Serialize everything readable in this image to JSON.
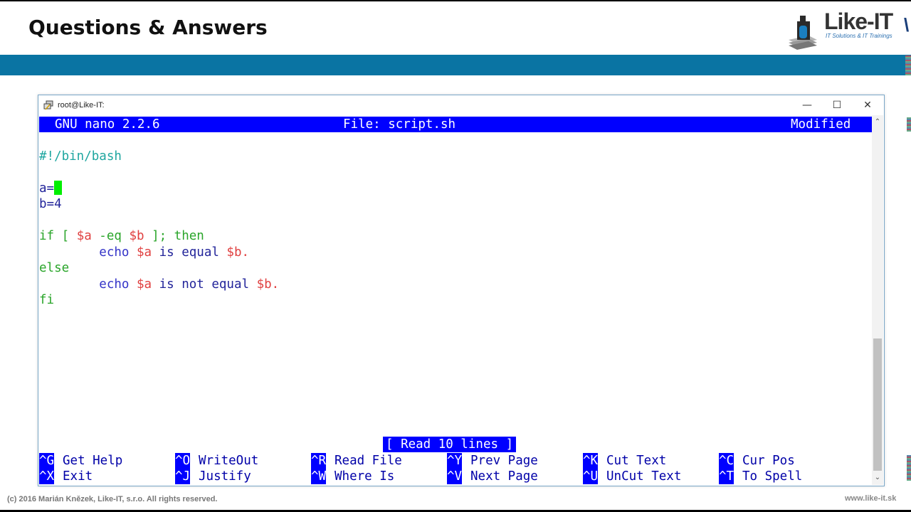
{
  "slide": {
    "title": "Questions & Answers",
    "logo": {
      "name": "Like-IT",
      "tagline": "IT Solutions & IT Trainings"
    },
    "footer_copyright": "(c) 2016 Marián Knězek, Like-IT, s.r.o. All rights reserved.",
    "footer_url": "www.like-it.sk",
    "band_color": "#0a74a3"
  },
  "window": {
    "title": "root@Like-IT:",
    "buttons": {
      "minimize": "—",
      "maximize": "☐",
      "close": "✕"
    }
  },
  "nano": {
    "header": {
      "app": "GNU nano 2.2.6",
      "file": "File: script.sh",
      "state": "Modified"
    },
    "lines": {
      "shebang": "#!/bin/bash",
      "a_assign": "a=",
      "b_assign": "b=4",
      "if_kw": "if [ ",
      "if_var_a": "$a",
      "if_op": " -eq ",
      "if_var_b": "$b",
      "if_end": " ]; then",
      "indent": "        ",
      "echo": "echo ",
      "echo1_var_a": "$a",
      "echo1_text": " is equal ",
      "echo1_var_b": "$b.",
      "else_kw": "else",
      "echo2_var_a": "$a",
      "echo2_text": " is not equal ",
      "echo2_var_b": "$b.",
      "fi_kw": "fi"
    },
    "status": "[ Read 10 lines ]",
    "shortcuts": [
      {
        "key": "^G",
        "label": "Get Help"
      },
      {
        "key": "^O",
        "label": "WriteOut"
      },
      {
        "key": "^R",
        "label": "Read File"
      },
      {
        "key": "^Y",
        "label": "Prev Page"
      },
      {
        "key": "^K",
        "label": "Cut Text"
      },
      {
        "key": "^C",
        "label": "Cur Pos"
      },
      {
        "key": "^X",
        "label": "Exit"
      },
      {
        "key": "^J",
        "label": "Justify"
      },
      {
        "key": "^W",
        "label": "Where Is"
      },
      {
        "key": "^V",
        "label": "Next Page"
      },
      {
        "key": "^U",
        "label": "UnCut Text"
      },
      {
        "key": "^T",
        "label": "To Spell"
      }
    ]
  }
}
